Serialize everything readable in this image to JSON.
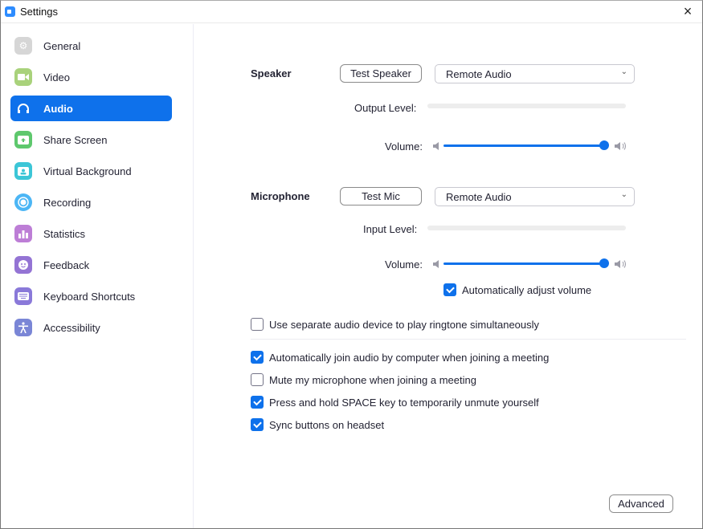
{
  "window": {
    "title": "Settings",
    "close_label": "×"
  },
  "sidebar": {
    "items": [
      {
        "label": "General",
        "icon": "gear-icon",
        "color": "#d6d6d6",
        "active": false
      },
      {
        "label": "Video",
        "icon": "video-camera-icon",
        "color": "#a9d27b",
        "active": false
      },
      {
        "label": "Audio",
        "icon": "headphones-icon",
        "color": "#0e71eb",
        "active": true
      },
      {
        "label": "Share Screen",
        "icon": "share-screen-icon",
        "color": "#5ec86d",
        "active": false
      },
      {
        "label": "Virtual Background",
        "icon": "virtual-background-icon",
        "color": "#3cc6d7",
        "active": false
      },
      {
        "label": "Recording",
        "icon": "recording-icon",
        "color": "#4cb6f5",
        "active": false
      },
      {
        "label": "Statistics",
        "icon": "statistics-icon",
        "color": "#bd7ed6",
        "active": false
      },
      {
        "label": "Feedback",
        "icon": "feedback-icon",
        "color": "#9474d4",
        "active": false
      },
      {
        "label": "Keyboard Shortcuts",
        "icon": "keyboard-icon",
        "color": "#8a79d9",
        "active": false
      },
      {
        "label": "Accessibility",
        "icon": "accessibility-icon",
        "color": "#7a86d6",
        "active": false
      }
    ]
  },
  "speaker": {
    "label": "Speaker",
    "test_button": "Test Speaker",
    "device": "Remote Audio",
    "output_level_label": "Output Level:",
    "output_level": 0,
    "volume_label": "Volume:",
    "volume": 1.0
  },
  "microphone": {
    "label": "Microphone",
    "test_button": "Test Mic",
    "device": "Remote Audio",
    "input_level_label": "Input Level:",
    "input_level": 0,
    "volume_label": "Volume:",
    "volume": 1.0,
    "auto_adjust_label": "Automatically adjust volume",
    "auto_adjust": true
  },
  "options": [
    {
      "label": "Use separate audio device to play ringtone simultaneously",
      "checked": false
    },
    {
      "label": "Automatically join audio by computer when joining a meeting",
      "checked": true
    },
    {
      "label": "Mute my microphone when joining a meeting",
      "checked": false
    },
    {
      "label": "Press and hold SPACE key to temporarily unmute yourself",
      "checked": true
    },
    {
      "label": "Sync buttons on headset",
      "checked": true
    }
  ],
  "advanced_button": "Advanced",
  "colors": {
    "accent": "#0e71eb"
  }
}
